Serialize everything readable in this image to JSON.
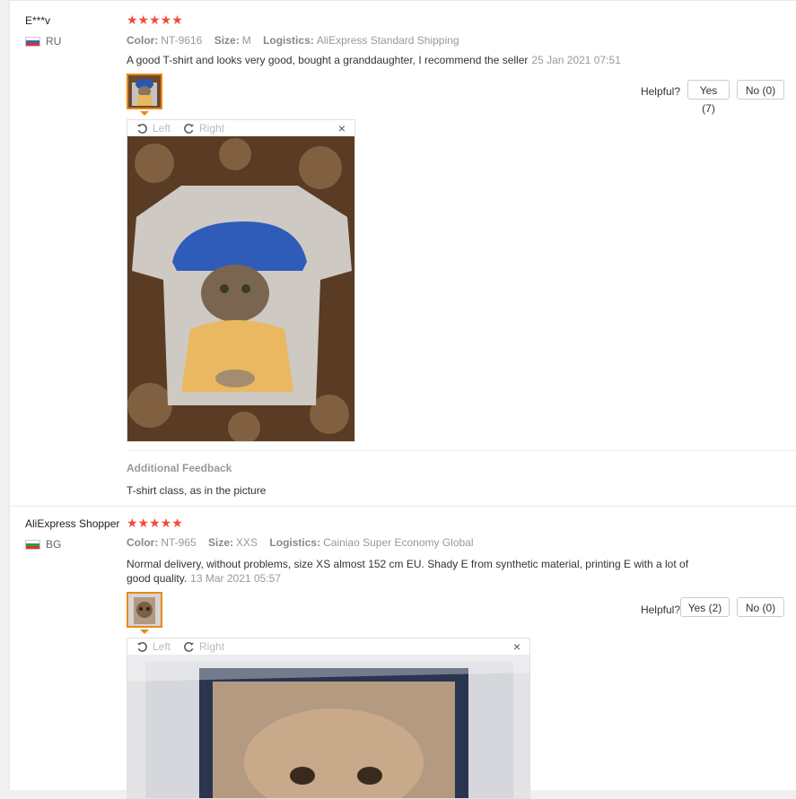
{
  "reviews": [
    {
      "name": "E***v",
      "country": "RU",
      "stars": "★★★★★",
      "color_label": "Color:",
      "color": "NT-9616",
      "size_label": "Size:",
      "size": "M",
      "logistics_label": "Logistics:",
      "logistics": "AliExpress Standard Shipping",
      "text": "A good T-shirt and looks very good, bought a granddaughter, I recommend the seller",
      "date": "25 Jan 2021 07:51",
      "helpful_label": "Helpful?",
      "yes_label": "Yes (7)",
      "no_label": "No (0)",
      "viewer": {
        "left_label": "Left",
        "right_label": "Right",
        "close": "×"
      },
      "additional_title": "Additional Feedback",
      "additional_text": "T-shirt class, as in the picture"
    },
    {
      "name": "AliExpress Shopper",
      "country": "BG",
      "stars": "★★★★★",
      "color_label": "Color:",
      "color": "NT-965",
      "size_label": "Size:",
      "size": "XXS",
      "logistics_label": "Logistics:",
      "logistics": "Cainiao Super Economy Global",
      "text_line1": "Normal delivery, without problems, size XS almost 152 cm EU. Shady E from synthetic material, printing E with a lot of",
      "text_line2": "good quality.",
      "date": "13 Mar 2021 05:57",
      "helpful_label": "Helpful?",
      "yes_label": "Yes (2)",
      "no_label": "No (0)",
      "viewer": {
        "left_label": "Left",
        "right_label": "Right",
        "close": "×"
      }
    }
  ],
  "colors": {
    "star": "#f04b3a",
    "thumb_border": "#e88a1a"
  },
  "icons": {
    "rotate_left": "rotate-left-icon",
    "rotate_right": "rotate-right-icon",
    "close": "close-icon"
  }
}
